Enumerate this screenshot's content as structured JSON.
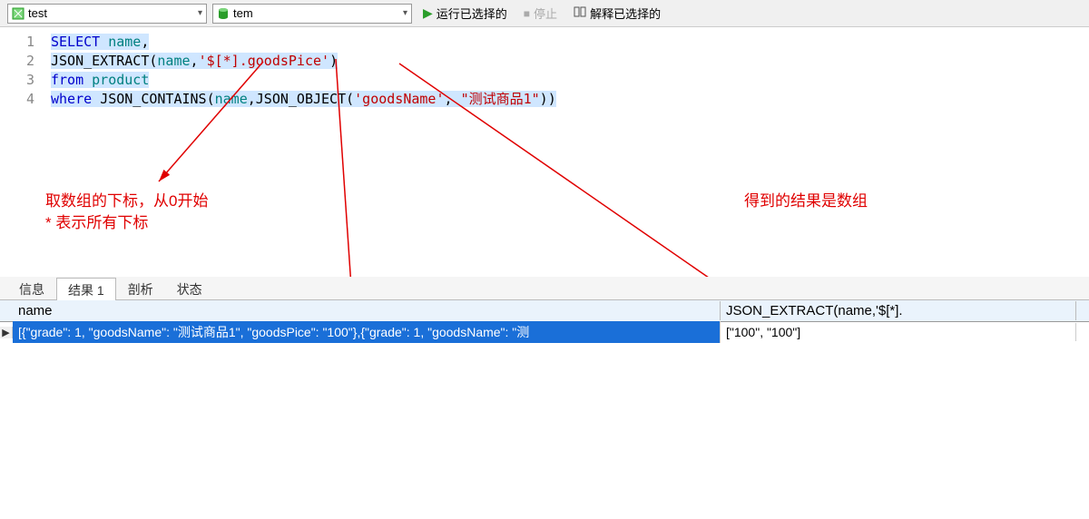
{
  "toolbar": {
    "connection": "test",
    "database": "tem",
    "run_label": "运行已选择的",
    "stop_label": "停止",
    "explain_label": "解释已选择的"
  },
  "code": {
    "lines": [
      {
        "num": 1,
        "tokens": [
          [
            "kw",
            "SELECT"
          ],
          [
            "",
            ""
          ],
          [
            "id",
            "name"
          ],
          [
            "",
            ","
          ]
        ]
      },
      {
        "num": 2,
        "tokens": [
          [
            "func",
            "JSON_EXTRACT"
          ],
          [
            "",
            "("
          ],
          [
            "id",
            "name"
          ],
          [
            "",
            ","
          ],
          [
            "str",
            "'$[*].goodsPice'"
          ],
          [
            "",
            ")"
          ]
        ]
      },
      {
        "num": 3,
        "tokens": [
          [
            "kw",
            "from"
          ],
          [
            "",
            ""
          ],
          [
            "id",
            "product"
          ]
        ]
      },
      {
        "num": 4,
        "tokens": [
          [
            "kw",
            "where"
          ],
          [
            "",
            ""
          ],
          [
            "func",
            "JSON_CONTAINS"
          ],
          [
            "",
            "("
          ],
          [
            "id",
            "name"
          ],
          [
            "",
            ","
          ],
          [
            "func",
            "JSON_OBJECT"
          ],
          [
            "",
            "("
          ],
          [
            "str",
            "'goodsName'"
          ],
          [
            "",
            ", "
          ],
          [
            "str",
            "\"测试商品1\""
          ],
          [
            "",
            ")"
          ],
          [
            "",
            ")"
          ]
        ]
      }
    ]
  },
  "annotations": {
    "left_line1": "取数组的下标，从0开始",
    "left_line2": "* 表示所有下标",
    "right": "得到的结果是数组"
  },
  "tabs": {
    "items": [
      "信息",
      "结果 1",
      "剖析",
      "状态"
    ],
    "active_index": 1
  },
  "grid": {
    "columns": [
      "name",
      "JSON_EXTRACT(name,'$[*]."
    ],
    "rows": [
      {
        "name": "[{\"grade\": 1, \"goodsName\": \"测试商品1\", \"goodsPice\": \"100\"},{\"grade\": 1, \"goodsName\": \"测",
        "json": "[\"100\", \"100\"]"
      }
    ]
  }
}
